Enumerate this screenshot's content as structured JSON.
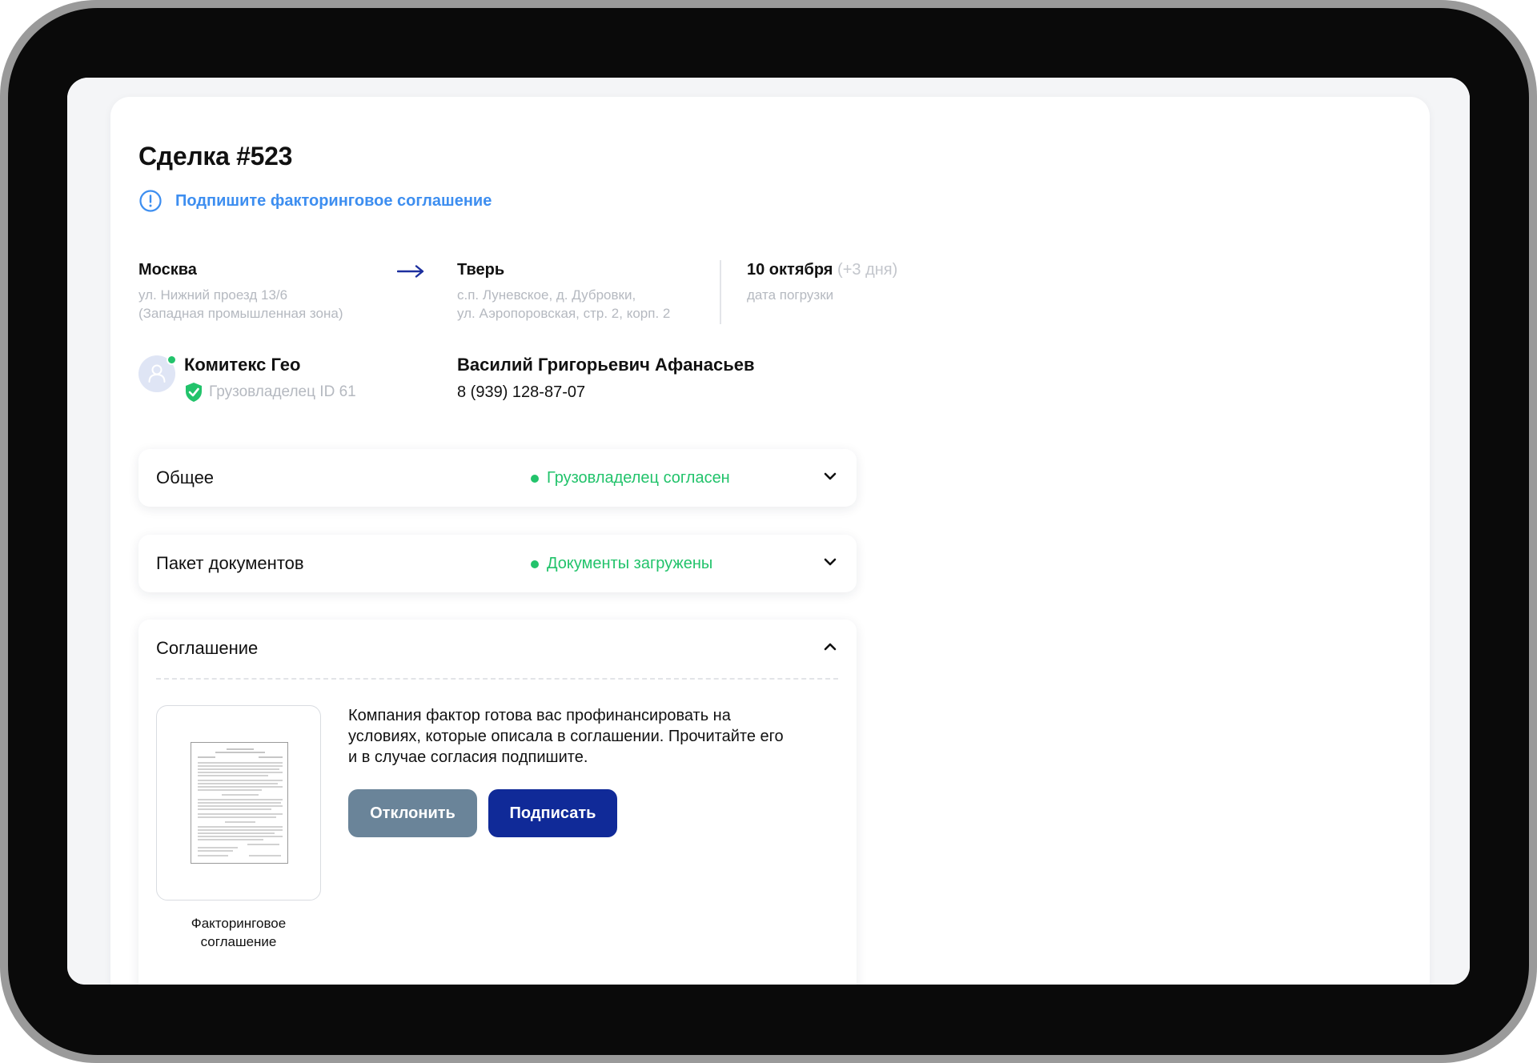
{
  "deal": {
    "title": "Сделка #523",
    "alert": "Подпишите факторинговое соглашение"
  },
  "route": {
    "from": {
      "city": "Москва",
      "address_line1": "ул. Нижний проезд 13/6",
      "address_line2": "(Западная промышленная зона)"
    },
    "to": {
      "city": "Тверь",
      "address_line1": "с.п. Луневское, д. Дубровки,",
      "address_line2": "ул. Аэропоровская, стр. 2, корп. 2"
    },
    "date": {
      "value": "10 октября",
      "extra": "(+3 дня)",
      "label": "дата погрузки"
    }
  },
  "company": {
    "name": "Комитекс Гео",
    "role": "Грузовладелец ID 61"
  },
  "contact": {
    "name": "Василий Григорьевич Афанасьев",
    "phone": "8 (939) 128-87-07"
  },
  "sections": {
    "general": {
      "title": "Общее",
      "status": "Грузовладелец согласен"
    },
    "documents": {
      "title": "Пакет документов",
      "status": "Документы загружены"
    },
    "agreement": {
      "title": "Соглашение",
      "text": "Компания фактор готова вас профинансировать на условиях, которые описала в соглашении. Прочитайте его и в случае согласия подпишите.",
      "doc_caption": "Факторинговое соглашение",
      "decline_label": "Отклонить",
      "sign_label": "Подписать"
    }
  },
  "colors": {
    "accent_blue": "#3d8ef0",
    "status_green": "#22c36b",
    "primary_button": "#102a98",
    "secondary_button": "#6a8499",
    "muted_text": "#b5b9c0"
  },
  "icons": {
    "alert": "info-circle-icon",
    "route": "arrow-right-icon",
    "verified": "shield-check-icon",
    "collapsed": "chevron-down-icon",
    "expanded": "chevron-up-icon"
  }
}
